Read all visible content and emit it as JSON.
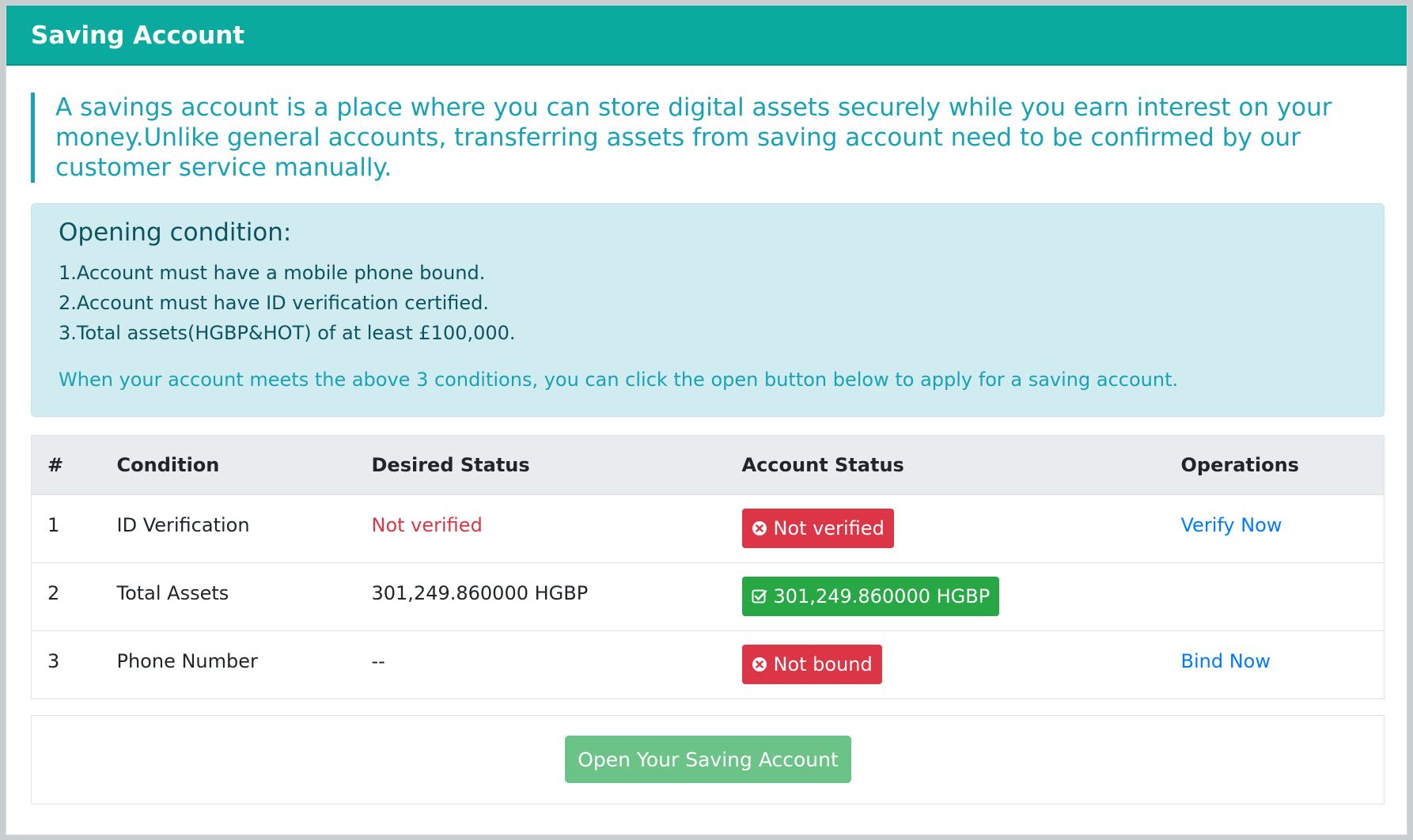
{
  "header": {
    "title": "Saving Account"
  },
  "intro": {
    "text": "A savings account is a place where you can store digital assets securely while you earn interest on your money.Unlike general accounts, transferring assets from saving account need to be confirmed by our customer service manually."
  },
  "conditions": {
    "heading": "Opening condition:",
    "items": [
      "1.Account must have a mobile phone bound.",
      "2.Account must have ID verification certified.",
      "3.Total assets(HGBP&HOT) of at least £100,000."
    ],
    "note": "When your account meets the above 3 conditions, you can click the open button below to apply for a saving account."
  },
  "table": {
    "headers": [
      "#",
      "Condition",
      "Desired Status",
      "Account Status",
      "Operations"
    ],
    "rows": [
      {
        "num": "1",
        "condition": "ID Verification",
        "desired": "Not verified",
        "status": "Not verified",
        "status_type": "error",
        "status_icon": "times-circle-icon",
        "operation": "Verify Now"
      },
      {
        "num": "2",
        "condition": "Total Assets",
        "desired": "301,249.860000 HGBP",
        "status": "301,249.860000 HGBP",
        "status_type": "success",
        "status_icon": "check-square-icon",
        "operation": ""
      },
      {
        "num": "3",
        "condition": "Phone Number",
        "desired": "--",
        "status": "Not bound",
        "status_type": "error",
        "status_icon": "times-circle-icon",
        "operation": "Bind Now"
      }
    ]
  },
  "open_button": {
    "label": "Open Your Saving Account"
  },
  "colors": {
    "header_bg": "#0aab9e",
    "info_text": "#17a2b8",
    "info_bg": "#d1ecf1",
    "danger": "#dc3545",
    "success": "#28a745",
    "link": "#007bff",
    "open_button_bg": "#6cc387"
  }
}
